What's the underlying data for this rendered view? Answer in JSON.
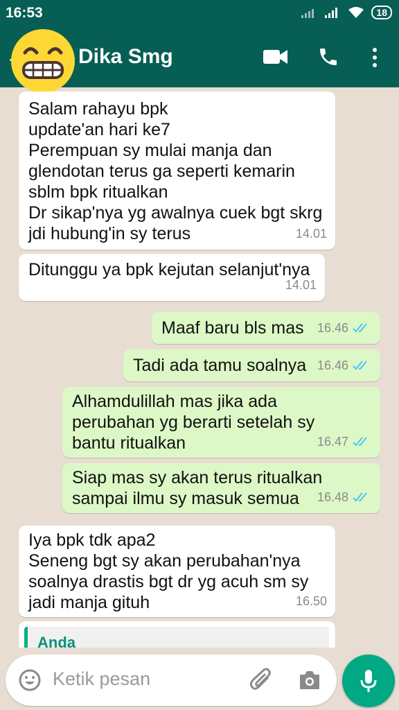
{
  "status_bar": {
    "time": "16:53",
    "battery": "18"
  },
  "header": {
    "contact_name": "Dika Smg"
  },
  "messages": [
    {
      "direction": "in",
      "text": "Salam rahayu bpk\nupdate'an hari ke7\nPerempuan sy mulai manja dan\nglendotan terus ga seperti kemarin\nsblm bpk ritualkan\nDr sikap'nya yg awalnya cuek bgt skrg\njdi hubung'in sy terus",
      "time": "14.01"
    },
    {
      "direction": "in",
      "text": "Ditunggu ya bpk kejutan selanjut'nya",
      "time": "14.01"
    },
    {
      "direction": "out",
      "text": "Maaf baru bls mas",
      "time": "16.46",
      "read": true
    },
    {
      "direction": "out",
      "text": "Tadi ada tamu soalnya",
      "time": "16.46",
      "read": true
    },
    {
      "direction": "out",
      "text": "Alhamdulillah mas jika ada\nperubahan yg berarti setelah sy\nbantu ritualkan",
      "time": "16.47",
      "read": true
    },
    {
      "direction": "out",
      "text": "Siap mas sy akan terus ritualkan\nsampai ilmu sy masuk semua",
      "time": "16.48",
      "read": true
    },
    {
      "direction": "in",
      "text": "Iya bpk tdk apa2\nSeneng bgt sy akan perubahan'nya\nsoalnya drastis bgt dr yg acuh sm sy\njadi manja gituh",
      "time": "16.50"
    }
  ],
  "reply_preview": {
    "sender": "Anda"
  },
  "composer": {
    "placeholder": "Ketik pesan"
  },
  "colors": {
    "header": "#075e54",
    "outgoing": "#dcf8c6",
    "incoming": "#ffffff",
    "tick_read": "#4fc3f7",
    "accent": "#00a884"
  }
}
